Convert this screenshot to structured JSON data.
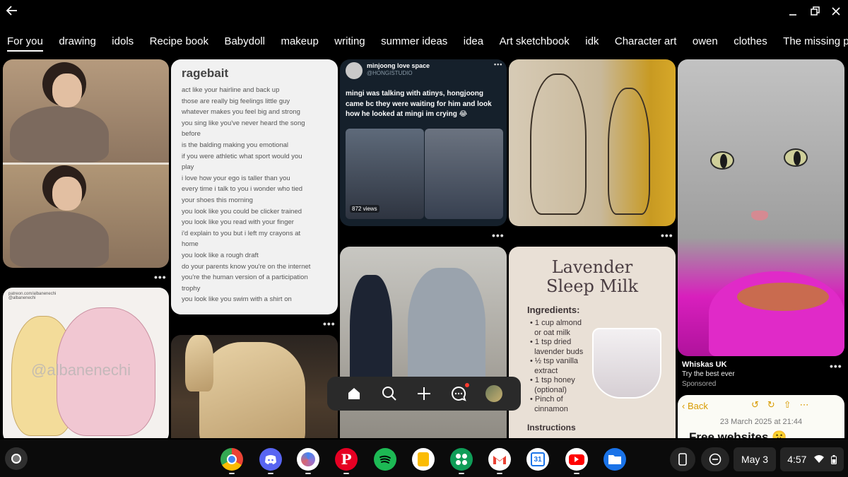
{
  "window": {
    "back_icon": "arrow-left-icon",
    "controls": [
      "minimize-icon",
      "maximize-icon",
      "close-icon"
    ]
  },
  "tabs": [
    {
      "label": "For you",
      "active": true
    },
    {
      "label": "drawing"
    },
    {
      "label": "idols"
    },
    {
      "label": "Recipe book"
    },
    {
      "label": "Babydoll"
    },
    {
      "label": "makeup"
    },
    {
      "label": "writing"
    },
    {
      "label": "summer ideas"
    },
    {
      "label": "idea"
    },
    {
      "label": "Art sketchbook"
    },
    {
      "label": "idk"
    },
    {
      "label": "Character art"
    },
    {
      "label": "owen"
    },
    {
      "label": "clothes"
    },
    {
      "label": "The missing peice"
    }
  ],
  "pins": {
    "more_label": "•••",
    "sketch": {
      "handle_line1": "patreon.com/albanenechi",
      "handle_line2": "@albanenechi",
      "watermark": "@albanenechi"
    },
    "rage": {
      "title": "ragebait",
      "lines": [
        "act like your hairline and back up",
        "those are really big feelings little guy",
        "whatever makes you feel big and strong",
        "you sing like you've never heard the song",
        "before",
        "is the balding making you emotional",
        "if you were athletic what sport would you",
        "play",
        "i love how your ego is taller than you",
        "every time i talk to you i wonder who tied",
        "your shoes this morning",
        "you look like you could be clicker trained",
        "you look like you read with your finger",
        "i'd explain to you but i left my crayons at",
        "home",
        "you look like a rough draft",
        "do your parents know you're on the internet",
        "you're the human version of a participation",
        "trophy",
        "you look like you swim with a shirt on"
      ]
    },
    "tweet": {
      "name": "minjoong love space",
      "handle": "@HONGISTUDIO",
      "text": "mingi was talking with atinys, hongjoong came bc they were waiting for him and look how he looked at mingi im crying 😂",
      "views": "872 views"
    },
    "lavender": {
      "title_line1": "Lavender",
      "title_line2": "Sleep Milk",
      "ingredients_label": "Ingredients:",
      "ingredients": [
        "• 1 cup almond",
        "  or oat milk",
        "• 1 tsp dried",
        "  lavender buds",
        "• ½ tsp vanilla",
        "  extract",
        "• 1 tsp honey",
        "  (optional)",
        "• Pinch of",
        "  cinnamon"
      ],
      "instructions_label": "Instructions"
    },
    "ad": {
      "title": "Whiskas UK",
      "subtitle": "Try the best ever",
      "sponsored": "Sponsored"
    },
    "notes": {
      "back": "‹ Back",
      "date": "23 March 2025 at 21:44",
      "heading": "Free websites 🤫"
    }
  },
  "floating_nav": {
    "items": [
      "home-icon",
      "search-icon",
      "plus-icon",
      "messages-icon",
      "profile-avatar"
    ],
    "accent": "#ff3b30"
  },
  "shelf": {
    "apps": [
      {
        "name": "Chrome",
        "color": "#4285f4"
      },
      {
        "name": "Discord",
        "color": "#5865f2"
      },
      {
        "name": "Gemini",
        "color": "#ffffff"
      },
      {
        "name": "Pinterest",
        "color": "#e60023"
      },
      {
        "name": "Spotify",
        "color": "#1db954"
      },
      {
        "name": "Keep",
        "color": "#fbbc04"
      },
      {
        "name": "Sheets",
        "color": "#0f9d58"
      },
      {
        "name": "Gmail",
        "color": "#ffffff"
      },
      {
        "name": "Calendar",
        "color": "#ffffff"
      },
      {
        "name": "YouTube",
        "color": "#ff0000"
      },
      {
        "name": "Files",
        "color": "#1a73e8"
      }
    ],
    "calendar_day": "31",
    "date": "May 3",
    "time": "4:57"
  }
}
